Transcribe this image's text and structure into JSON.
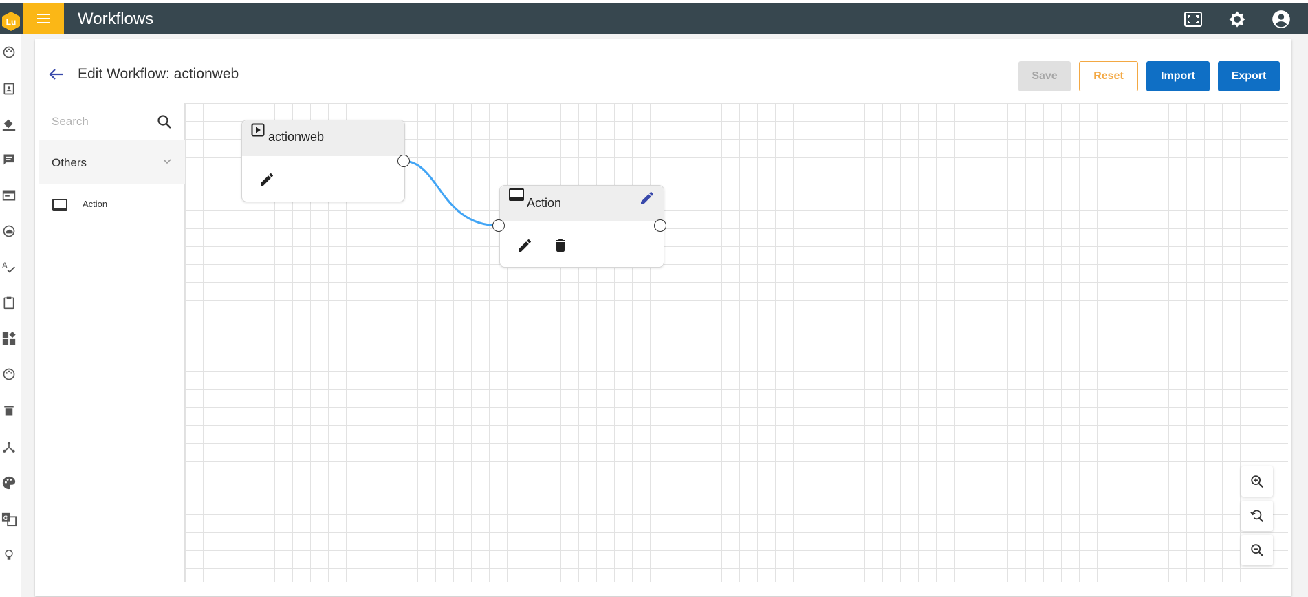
{
  "app": {
    "title": "Workflows",
    "logo_text": "Lu",
    "colors": {
      "topbar": "#37474f",
      "menu_accent": "#fbb716",
      "primary": "#0f6fc5",
      "reset": "#f3a843",
      "wire": "#42a5f5"
    }
  },
  "header": {
    "title": "Edit Workflow: actionweb",
    "buttons": {
      "save": "Save",
      "reset": "Reset",
      "import": "Import",
      "export": "Export"
    }
  },
  "palette": {
    "search_placeholder": "Search",
    "group": "Others",
    "items": [
      {
        "label": "Action",
        "icon": "web-asset-icon"
      }
    ]
  },
  "canvas": {
    "nodes": [
      {
        "title": "actionweb",
        "icon": "play-box-icon"
      },
      {
        "title": "Action",
        "icon": "web-asset-icon"
      }
    ]
  },
  "rail_icons": [
    "palette-icon",
    "contact-icon",
    "format-paint-icon",
    "comment-icon",
    "web-icon",
    "cloud-icon",
    "spellcheck-icon",
    "clipboard-icon",
    "widgets-icon",
    "palette-icon",
    "trash-icon",
    "hub-icon",
    "color-palette-icon",
    "translate-icon",
    "lightbulb-icon"
  ]
}
